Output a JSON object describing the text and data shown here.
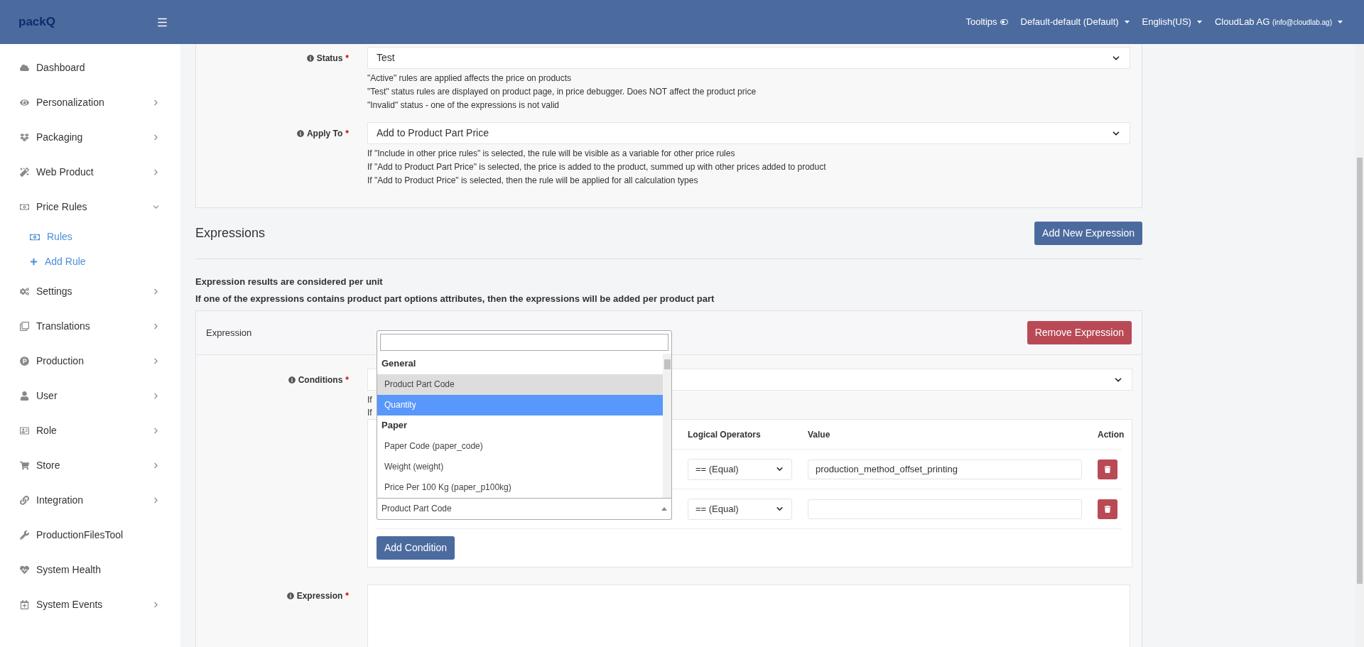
{
  "header": {
    "logo": "packQ",
    "tooltips": {
      "label": "Tooltips",
      "on": false
    },
    "menus": [
      "Default-default (Default)",
      "English(US)"
    ],
    "user": {
      "name": "CloudLab AG",
      "email": "(info@cloudlab.ag)"
    }
  },
  "sidebar": {
    "items": [
      {
        "label": "Dashboard"
      },
      {
        "label": "Personalization",
        "expanded": false
      },
      {
        "label": "Packaging",
        "expanded": false
      },
      {
        "label": "Web Product",
        "expanded": false
      },
      {
        "label": "Price Rules",
        "expanded": true,
        "children": [
          {
            "label": "Rules"
          },
          {
            "label": "Add Rule"
          }
        ]
      },
      {
        "label": "Settings",
        "expanded": false
      },
      {
        "label": "Translations",
        "expanded": false
      },
      {
        "label": "Production",
        "expanded": false
      },
      {
        "label": "User",
        "expanded": false
      },
      {
        "label": "Role",
        "expanded": false
      },
      {
        "label": "Store",
        "expanded": false
      },
      {
        "label": "Integration",
        "expanded": false
      },
      {
        "label": "ProductionFilesTool"
      },
      {
        "label": "System Health"
      },
      {
        "label": "System Events",
        "expanded": false
      }
    ]
  },
  "fields": [
    {
      "label": "Status",
      "required_mark": "*",
      "value": "Test",
      "help": [
        "\"Active\" rules are applied affects the price on products",
        "\"Test\" status rules are displayed on product page, in price debugger. Does NOT affect the product price",
        "\"Invalid\" status - one of the expressions is not valid"
      ]
    },
    {
      "label": "Apply To",
      "required_mark": "*",
      "value": "Add to Product Part Price",
      "help": [
        "If \"Include in other price rules\" is selected, the rule will be visible as a variable for other price rules",
        "If \"Add to Product Part Price\" is selected, the price is added to the product, summed up with other prices added to product",
        "If \"Add to Product Price\" is selected, then the rule will be applied for all calculation types"
      ]
    }
  ],
  "expressions": {
    "title": "Expressions",
    "add_button": "Add New Expression",
    "notes": [
      "Expression results are considered per unit",
      "If one of the expressions contains product part options attributes, then the expressions will be added per product part"
    ],
    "card": {
      "title": "Expression",
      "remove_button": "Remove Expression",
      "conditions": {
        "label": "Conditions",
        "required_mark": "*",
        "help": [
          "If",
          "If"
        ]
      },
      "table": {
        "columns": [
          "Logical Operators",
          "Value",
          "Action"
        ],
        "rows": [
          {
            "operator": "== (Equal)",
            "value": "production_method_offset_printing"
          },
          {
            "field": "Product Part Code",
            "operator": "== (Equal)"
          }
        ]
      },
      "dropdown": {
        "groups": [
          {
            "label": "General",
            "options": [
              {
                "label": "Product Part Code",
                "selected": true,
                "highlighted": false
              },
              {
                "label": "Quantity",
                "selected": false,
                "highlighted": true
              }
            ]
          },
          {
            "label": "Paper",
            "options": [
              {
                "label": "Paper Code (paper_code)",
                "selected": false,
                "highlighted": false
              },
              {
                "label": "Weight (weight)",
                "selected": false,
                "highlighted": false
              },
              {
                "label": "Price Per 100 Kg (paper_p100kg)",
                "selected": false,
                "highlighted": false
              }
            ]
          }
        ]
      },
      "add_condition": "Add Condition",
      "expression": {
        "label": "Expression",
        "required_mark": "*"
      }
    }
  }
}
